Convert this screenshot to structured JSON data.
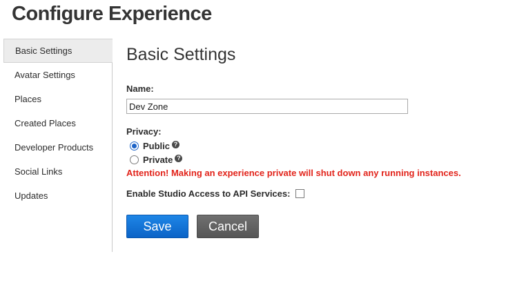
{
  "page": {
    "title": "Configure Experience"
  },
  "sidebar": {
    "items": [
      {
        "label": "Basic Settings",
        "active": true
      },
      {
        "label": "Avatar Settings"
      },
      {
        "label": "Places"
      },
      {
        "label": "Created Places"
      },
      {
        "label": "Developer Products"
      },
      {
        "label": "Social Links"
      },
      {
        "label": "Updates"
      }
    ]
  },
  "main": {
    "section_title": "Basic Settings",
    "name": {
      "label": "Name:",
      "value": "Dev Zone"
    },
    "privacy": {
      "label": "Privacy:",
      "options": [
        {
          "label": "Public",
          "selected": true,
          "icon": "help-icon"
        },
        {
          "label": "Private",
          "selected": false,
          "icon": "help-icon"
        }
      ],
      "warning": "Attention! Making an experience private will shut down any running instances."
    },
    "studio_access": {
      "label": "Enable Studio Access to API Services:",
      "checked": false
    },
    "buttons": {
      "save": "Save",
      "cancel": "Cancel"
    }
  },
  "colors": {
    "primary": "#0b63c7",
    "warning": "#e2231a",
    "cancel": "#565656"
  }
}
